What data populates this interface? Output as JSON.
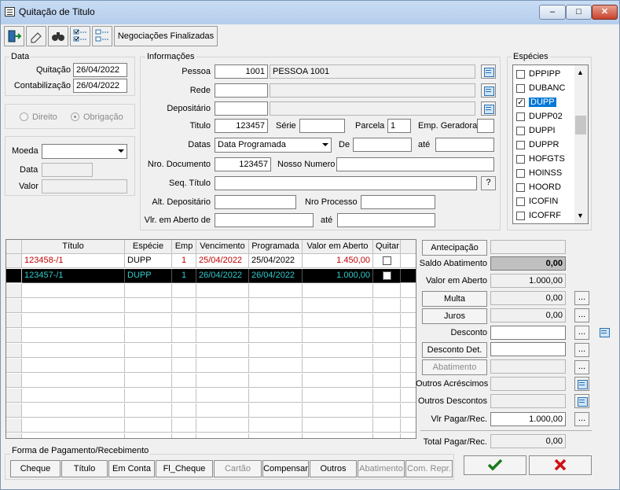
{
  "window": {
    "title": "Quitação de Titulo",
    "min": "–",
    "max": "□",
    "close": "✕"
  },
  "toolbar": {
    "negociacoes": "Negociações Finalizadas"
  },
  "data_group": {
    "title": "Data",
    "quitacao_label": "Quitação",
    "quitacao_value": "26/04/2022",
    "contabilizacao_label": "Contabilização",
    "contabilizacao_value": "26/04/2022"
  },
  "direito_label": "Direito",
  "obrigacao_label": "Obrigação",
  "moeda": {
    "label": "Moeda",
    "data_label": "Data",
    "valor_label": "Valor"
  },
  "info": {
    "title": "Informações",
    "pessoa_label": "Pessoa",
    "pessoa_code": "1001",
    "pessoa_name": "PESSOA 1001",
    "rede_label": "Rede",
    "depositario_label": "Depositário",
    "titulo_label": "Titulo",
    "titulo_value": "123457",
    "serie_label": "Série",
    "parcela_label": "Parcela",
    "parcela_value": "1",
    "emp_geradora_label": "Emp. Geradora",
    "datas_label": "Datas",
    "datas_value": "Data Programada",
    "de_label": "De",
    "ate_label": "até",
    "nro_doc_label": "Nro. Documento",
    "nro_doc_value": "123457",
    "nosso_numero_label": "Nosso Numero",
    "seq_titulo_label": "Seq. Título",
    "help_label": "?",
    "alt_depositario_label": "Alt. Depositário",
    "nro_processo_label": "Nro Processo",
    "vlr_aberto_label": "Vlr. em Aberto de",
    "ate2_label": "até"
  },
  "especies": {
    "title": "Espécies",
    "items": [
      {
        "label": "DPPIPP",
        "checked": false,
        "selected": false
      },
      {
        "label": "DUBANC",
        "checked": false,
        "selected": false
      },
      {
        "label": "DUPP",
        "checked": true,
        "selected": true
      },
      {
        "label": "DUPP02",
        "checked": false,
        "selected": false
      },
      {
        "label": "DUPPI",
        "checked": false,
        "selected": false
      },
      {
        "label": "DUPPR",
        "checked": false,
        "selected": false
      },
      {
        "label": "HOFGTS",
        "checked": false,
        "selected": false
      },
      {
        "label": "HOINSS",
        "checked": false,
        "selected": false
      },
      {
        "label": "HOORD",
        "checked": false,
        "selected": false
      },
      {
        "label": "ICOFIN",
        "checked": false,
        "selected": false
      },
      {
        "label": "ICOFRF",
        "checked": false,
        "selected": false
      }
    ]
  },
  "grid": {
    "columns": [
      "Título",
      "Espécie",
      "Emp",
      "Vencimento",
      "Programada",
      "Valor em Aberto",
      "Quitar"
    ],
    "rows": [
      {
        "titulo": "123458-/1",
        "especie": "DUPP",
        "emp": "1",
        "vencimento": "25/04/2022",
        "programada": "25/04/2022",
        "valor": "1.450,00",
        "quitar": false
      },
      {
        "titulo": "123457-/1",
        "especie": "DUPP",
        "emp": "1",
        "vencimento": "26/04/2022",
        "programada": "26/04/2022",
        "valor": "1.000,00",
        "quitar": false
      }
    ]
  },
  "right": {
    "antecipacao": "Antecipação",
    "saldo_abatimento_label": "Saldo Abatimento",
    "saldo_abatimento_value": "0,00",
    "valor_aberto_label": "Valor em Aberto",
    "valor_aberto_value": "1.000,00",
    "multa": "Multa",
    "multa_value": "0,00",
    "juros": "Juros",
    "juros_value": "0,00",
    "desconto_label": "Desconto",
    "desconto_det": "Desconto Det.",
    "abatimento": "Abatimento",
    "outros_acrescimos_label": "Outros Acréscimos",
    "outros_descontos_label": "Outros Descontos",
    "vlr_pagar_label": "Vlr Pagar/Rec.",
    "vlr_pagar_value": "1.000,00",
    "total_label": "Total Pagar/Rec.",
    "total_value": "0,00",
    "ellipsis": "..."
  },
  "forma": {
    "title": "Forma de Pagamento/Recebimento",
    "buttons": [
      "Cheque",
      "Título",
      "Em Conta",
      "Fl_Cheque",
      "Cartão",
      "Compensar",
      "Outros",
      "Abatimento",
      "Com. Repr."
    ]
  },
  "colors": {
    "confirm": "#1a7a1a",
    "cancel": "#d01010",
    "selection": "#0078d7",
    "red_row": "#c00000",
    "cyan_row": "#33cccc"
  }
}
